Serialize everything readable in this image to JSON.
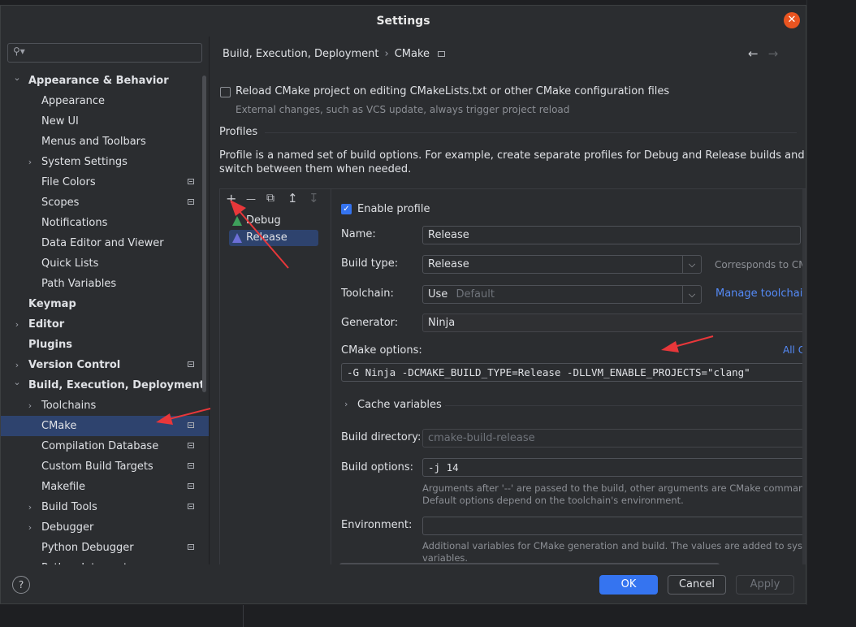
{
  "dialog": {
    "title": "Settings",
    "close_icon": "close-icon"
  },
  "search": {
    "placeholder": "",
    "icon": "search-icon"
  },
  "tree": [
    {
      "label": "Appearance & Behavior",
      "bold": true,
      "arrow": "down",
      "level": 0
    },
    {
      "label": "Appearance",
      "level": 1
    },
    {
      "label": "New UI",
      "level": 1
    },
    {
      "label": "Menus and Toolbars",
      "level": 1
    },
    {
      "label": "System Settings",
      "level": 1,
      "arrow": "right"
    },
    {
      "label": "File Colors",
      "level": 1,
      "page_icon": true
    },
    {
      "label": "Scopes",
      "level": 1,
      "page_icon": true
    },
    {
      "label": "Notifications",
      "level": 1
    },
    {
      "label": "Data Editor and Viewer",
      "level": 1
    },
    {
      "label": "Quick Lists",
      "level": 1
    },
    {
      "label": "Path Variables",
      "level": 1
    },
    {
      "label": "Keymap",
      "bold": true,
      "level": 0
    },
    {
      "label": "Editor",
      "bold": true,
      "level": 0,
      "arrow": "right"
    },
    {
      "label": "Plugins",
      "bold": true,
      "level": 0
    },
    {
      "label": "Version Control",
      "bold": true,
      "level": 0,
      "arrow": "right",
      "page_icon": true
    },
    {
      "label": "Build, Execution, Deployment",
      "bold": true,
      "level": 0,
      "arrow": "down"
    },
    {
      "label": "Toolchains",
      "level": 1,
      "arrow": "right"
    },
    {
      "label": "CMake",
      "level": 1,
      "page_icon": true,
      "selected": true
    },
    {
      "label": "Compilation Database",
      "level": 1,
      "page_icon": true
    },
    {
      "label": "Custom Build Targets",
      "level": 1,
      "page_icon": true
    },
    {
      "label": "Makefile",
      "level": 1,
      "page_icon": true
    },
    {
      "label": "Build Tools",
      "level": 1,
      "arrow": "right",
      "page_icon": true
    },
    {
      "label": "Debugger",
      "level": 1,
      "arrow": "right"
    },
    {
      "label": "Python Debugger",
      "level": 1,
      "page_icon": true
    },
    {
      "label": "Python Interpreter",
      "level": 1,
      "page_icon": true
    }
  ],
  "breadcrumb": {
    "parent": "Build, Execution, Deployment",
    "sep": "›",
    "current": "CMake"
  },
  "nav": {
    "back": "←",
    "forward": "→"
  },
  "reload": {
    "label": "Reload CMake project on editing CMakeLists.txt or other CMake configuration files",
    "hint": "External changes, such as VCS update, always trigger project reload",
    "checked": false
  },
  "profiles": {
    "heading": "Profiles",
    "description_1": "Profile is a named set of build options. For example, create separate profiles for Debug and Release builds and",
    "description_2": "switch between them when needed.",
    "toolbar": {
      "add": "+",
      "remove": "—",
      "copy": "⧉",
      "up": "↥",
      "down": "↧"
    },
    "items": [
      {
        "label": "Debug"
      },
      {
        "label": "Release",
        "selected": true
      }
    ]
  },
  "detail": {
    "enable_label": "Enable profile",
    "enabled": true,
    "name_label": "Name:",
    "name_value": "Release",
    "build_type_label": "Build type:",
    "build_type_value": "Release",
    "build_type_hint": "Corresponds to CMAK",
    "toolchain_label": "Toolchain:",
    "toolchain_use": "Use",
    "toolchain_default": "Default",
    "toolchain_link": "Manage toolchain",
    "generator_label": "Generator:",
    "generator_value": "Ninja",
    "cmake_options_label": "CMake options:",
    "cmake_options_link": "All C",
    "cmake_options_value": "-G Ninja -DCMAKE_BUILD_TYPE=Release -DLLVM_ENABLE_PROJECTS=\"clang\"",
    "cache_label": "Cache variables",
    "build_dir_label": "Build directory:",
    "build_dir_value": "cmake-build-release",
    "build_opts_label": "Build options:",
    "build_opts_value": "-j 14",
    "build_opts_hint_1": "Arguments after '--' are passed to the build, other arguments are CMake command lin",
    "build_opts_hint_2": "Default options depend on the toolchain's environment.",
    "env_label": "Environment:",
    "env_value": "",
    "env_hint_1": "Additional variables for CMake generation and build. The values are added to system",
    "env_hint_2": "variables."
  },
  "buttons": {
    "help": "?",
    "ok": "OK",
    "cancel": "Cancel",
    "apply": "Apply"
  },
  "colors": {
    "accent": "#3574f0",
    "selection": "#2e436e",
    "annotation": "#e8373a",
    "close": "#e95420"
  }
}
